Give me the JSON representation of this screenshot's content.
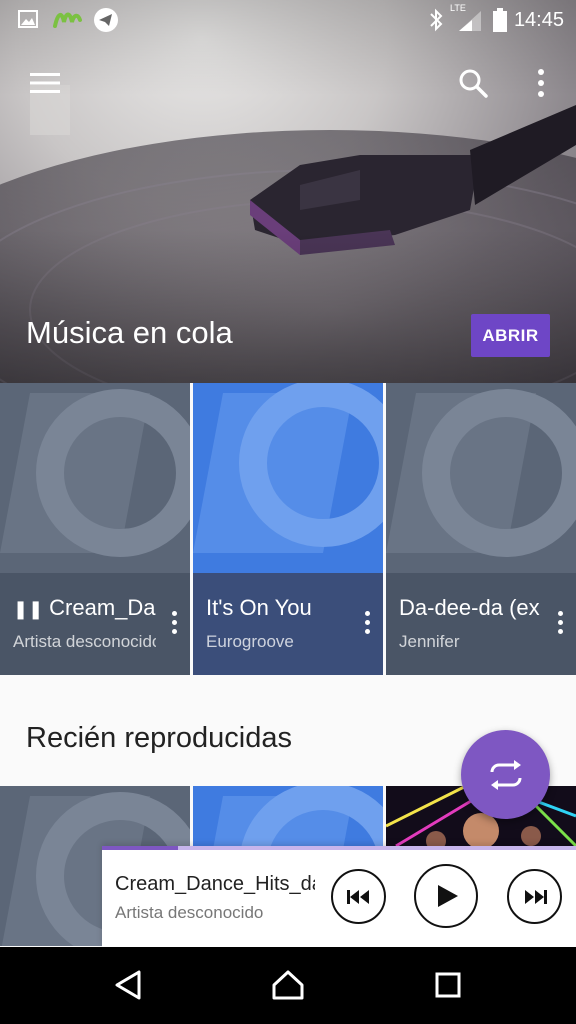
{
  "status_bar": {
    "time": "14:45",
    "network_label": "LTE",
    "left_icons": [
      "image-icon",
      "carrier-logo-icon",
      "telegram-icon"
    ],
    "right_icons": [
      "bluetooth-icon",
      "signal-icon",
      "battery-icon"
    ]
  },
  "app_bar": {
    "menu_icon": "menu-icon",
    "search_icon": "search-icon",
    "overflow_icon": "more-vert-icon"
  },
  "hero": {
    "title": "Música en cola",
    "open_button": "ABRIR"
  },
  "queue_cards": [
    {
      "title": "Cream_Dance_Hits_",
      "artist": "Artista desconocido",
      "playing": true,
      "art": "placeholder-grey",
      "info_color": "#4a5566"
    },
    {
      "title": "It's On You",
      "artist": "Eurogroove",
      "playing": false,
      "art": "placeholder-blue",
      "info_color": "#3b4e7a"
    },
    {
      "title": "Da-dee-da (ex",
      "artist": "Jennifer",
      "playing": false,
      "art": "placeholder-grey",
      "info_color": "#4a5566"
    }
  ],
  "recent": {
    "title": "Recién reproducidas"
  },
  "fab": {
    "icon": "shuffle-repeat-icon"
  },
  "mini_player": {
    "title": "Cream_Dance_Hits_dance",
    "artist": "Artista desconocido",
    "progress": 0.16,
    "prev_icon": "skip-previous-icon",
    "play_icon": "play-icon",
    "next_icon": "skip-next-icon"
  },
  "nav_bar": {
    "back_icon": "back-icon",
    "home_icon": "home-icon",
    "recents_icon": "recents-icon"
  },
  "colors": {
    "accent": "#7e57c2",
    "button_purple": "#6e46c6",
    "placeholder_grey": "#5b6677",
    "placeholder_blue": "#3f7be0"
  }
}
